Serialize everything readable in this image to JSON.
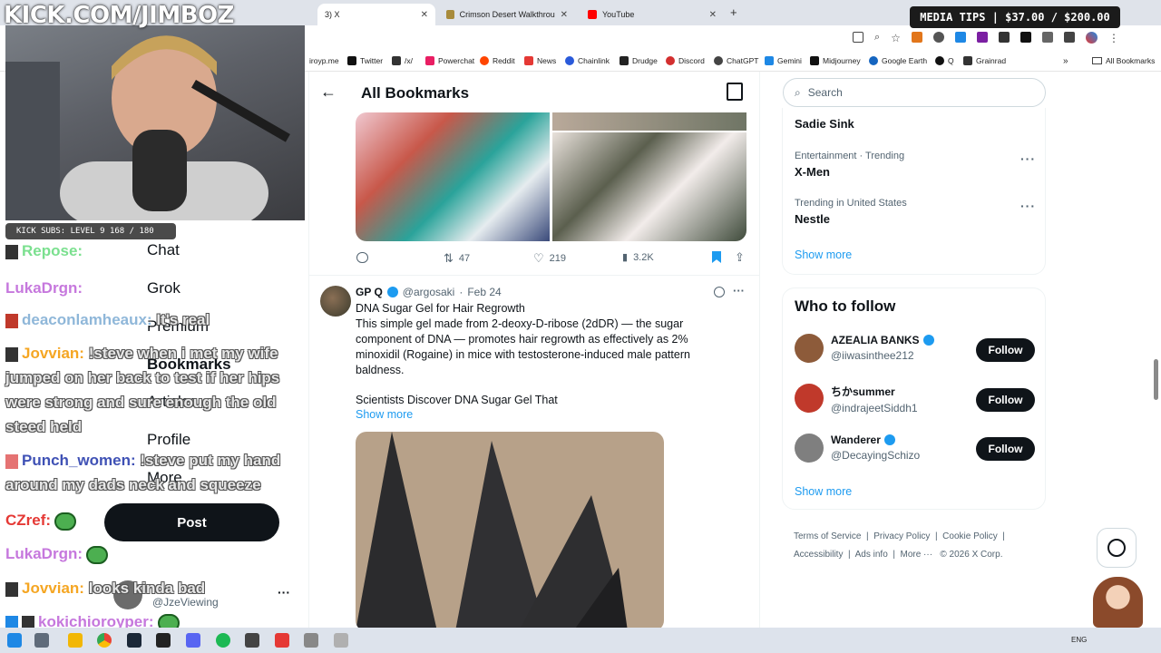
{
  "browser": {
    "tabs": [
      {
        "label": "3) X",
        "active": true
      },
      {
        "label": "Crimson Desert Walkthrough & ...",
        "active": false
      },
      {
        "label": "YouTube",
        "active": false
      }
    ],
    "new_tab": "+",
    "bookmarks": [
      {
        "label": "iroyp.me",
        "color": "#9e9e9e"
      },
      {
        "label": "Twitter",
        "color": "#111111"
      },
      {
        "label": "/x/",
        "color": "#333333"
      },
      {
        "label": "Powerchat",
        "color": "#e91e63"
      },
      {
        "label": "Reddit",
        "color": "#ff4500"
      },
      {
        "label": "News",
        "color": "#e53935"
      },
      {
        "label": "Chainlink",
        "color": "#2a5ada"
      },
      {
        "label": "Drudge",
        "color": "#222222"
      },
      {
        "label": "Discord",
        "color": "#d32f2f"
      },
      {
        "label": "ChatGPT",
        "color": "#444444"
      },
      {
        "label": "Gemini",
        "color": "#1e88e5"
      },
      {
        "label": "Midjourney",
        "color": "#111111"
      },
      {
        "label": "Google Earth",
        "color": "#1565c0"
      },
      {
        "label": "Q",
        "color": "#111111"
      },
      {
        "label": "Grainrad",
        "color": "#333333"
      }
    ],
    "all_bookmarks": "All Bookmarks"
  },
  "stream": {
    "kick_title": "KICK.COM/JIMBOZ",
    "subs_text": "KICK SUBS: LEVEL 9 168 / 180",
    "media_tips": "MEDIA TIPS | $37.00 / $200.00",
    "chat": [
      {
        "user": "Repose:",
        "color": "#7be08f",
        "msg": ""
      },
      {
        "user": "LukaDrgn:",
        "color": "#c678dd",
        "msg": ""
      },
      {
        "user": "deaconlamheaux:",
        "color": "#8fb7d9",
        "msg": "It's real"
      },
      {
        "user": "Jovvian:",
        "color": "#f5a623",
        "msg": "!steve when i met my wife"
      },
      {
        "user": "",
        "color": "#e8e8e8",
        "msg": "jumped on her back to test if her hips"
      },
      {
        "user": "",
        "color": "#e8e8e8",
        "msg": "were strong and sure enough the old"
      },
      {
        "user": "",
        "color": "#e8e8e8",
        "msg": "steed held"
      },
      {
        "user": "Punch_women:",
        "color": "#3f51b5",
        "msg": "!steve put my hand"
      },
      {
        "user": "",
        "color": "#e8e8e8",
        "msg": "around my dads neck and squeeze"
      },
      {
        "user": "CZref:",
        "color": "#e53935",
        "msg": ""
      },
      {
        "user": "LukaDrgn:",
        "color": "#c678dd",
        "msg": ""
      },
      {
        "user": "Jovvian:",
        "color": "#f5a623",
        "msg": "looks kinda bad"
      },
      {
        "user": "kokichioroyper:",
        "color": "#c678dd",
        "msg": ""
      }
    ]
  },
  "x": {
    "nav": {
      "chat": "Chat",
      "grok": "Grok",
      "premium": "Premium",
      "bookmarks": "Bookmarks",
      "articles": "Articles",
      "profile": "Profile",
      "more": "More",
      "post": "Post"
    },
    "account": {
      "handle": "@JzeViewing"
    },
    "header": {
      "title": "All Bookmarks"
    },
    "tweet1": {
      "replies": "",
      "reposts": "47",
      "likes": "219",
      "views": "3.2K"
    },
    "tweet2": {
      "name": "GP Q",
      "handle": "@argosaki",
      "date": "Feb 24",
      "title": "DNA Sugar Gel for Hair Regrowth",
      "body": "This simple gel made from 2-deoxy-D-ribose (2dDR) — the sugar component of DNA — promotes hair regrowth as effectively as 2% minoxidil (Rogaine) in mice with testosterone-induced male pattern baldness.",
      "body2": "Scientists Discover DNA Sugar Gel That",
      "show_more": "Show more"
    },
    "search": {
      "placeholder": "Search"
    },
    "trends": [
      {
        "meta": "",
        "name": "Sadie Sink"
      },
      {
        "meta": "Entertainment · Trending",
        "name": "X-Men"
      },
      {
        "meta": "Trending in United States",
        "name": "Nestle"
      }
    ],
    "trends_show_more": "Show more",
    "who_to_follow": {
      "title": "Who to follow",
      "items": [
        {
          "name": "AZEALIA BANKS",
          "handle": "@iiwasinthee212",
          "button": "Follow",
          "color": "#8d5b3a"
        },
        {
          "name": "ちかsummer",
          "handle": "@indrajeetSiddh1",
          "button": "Follow",
          "color": "#c0392b"
        },
        {
          "name": "Wanderer",
          "handle": "@DecayingSchizo",
          "button": "Follow",
          "color": "#7f7f7f"
        }
      ],
      "show_more": "Show more"
    },
    "footer": {
      "terms": "Terms of Service",
      "privacy": "Privacy Policy",
      "cookie": "Cookie Policy",
      "accessibility": "Accessibility",
      "ads": "Ads info",
      "more": "More ···",
      "copyright": "© 2026 X Corp."
    }
  },
  "taskbar": {
    "lang": "ENG"
  },
  "colors": {
    "accent": "#1d9bf0",
    "text": "#0f1419",
    "muted": "#536471"
  }
}
